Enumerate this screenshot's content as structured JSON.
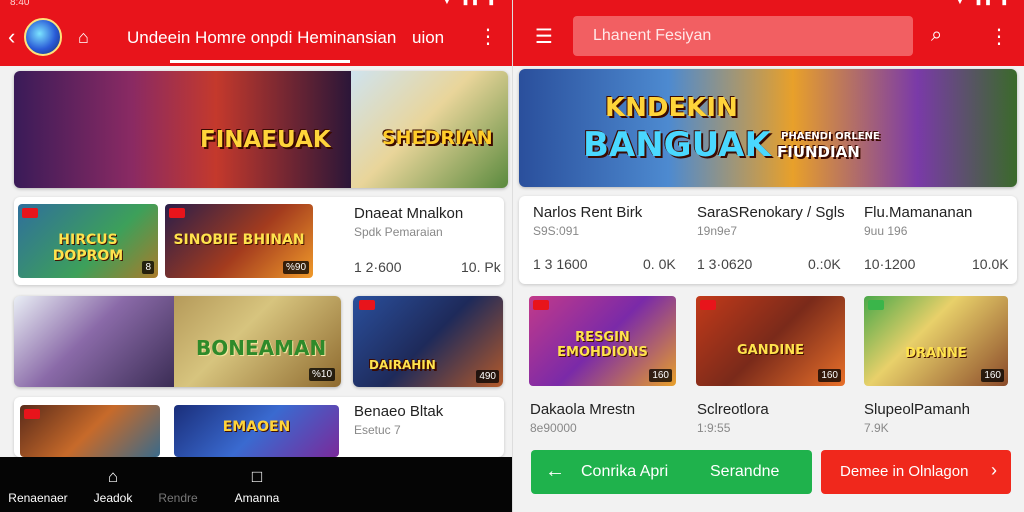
{
  "colors": {
    "primary": "#e8141b",
    "green": "#1fb24c",
    "red_button": "#f0281c",
    "nav_bg": "#050505"
  },
  "left": {
    "status": {
      "time": "8:40"
    },
    "header": {
      "back_icon": "chevron-left-icon",
      "home_icon": "home-icon",
      "title": "Undeein Homre onpdi Heminansian",
      "extra": "uion",
      "menu_icon": "more-vertical-icon"
    },
    "banners": [
      {
        "text": "FINAEUAK"
      },
      {
        "text": "SHEDRIAN"
      }
    ],
    "row1": {
      "thumbs": [
        {
          "title": "HIRCUS DOPROM",
          "badge": "8"
        },
        {
          "title": "SINOBIE BHINAN",
          "badge": "%90"
        }
      ],
      "title": "Dnaeat Mnalkon",
      "subtitle": "Spdk Pemaraian",
      "stat_left": "1 2·600",
      "stat_right": "10. Pk"
    },
    "row2": {
      "thumbs": [
        {
          "title": "",
          "badge": ""
        },
        {
          "title": "BONEAMAN",
          "badge": "%10"
        },
        {
          "title": "DAIRAHIN",
          "badge": "490"
        }
      ]
    },
    "row3": {
      "title": "Benaeo Bltak",
      "subtitle": "Esetuc 7",
      "thumbs": [
        {
          "title": "",
          "badge": ""
        },
        {
          "title": "EMAOEN",
          "badge": ""
        }
      ]
    },
    "bottom_nav": [
      {
        "label": "Renaenaer",
        "icon": ""
      },
      {
        "label": "Jeadok",
        "icon": "home-icon"
      },
      {
        "label": "Rendre",
        "icon": ""
      },
      {
        "label": "Amanna",
        "icon": "square-icon"
      }
    ]
  },
  "right": {
    "header": {
      "menu_icon": "hamburger-icon",
      "search_placeholder": "Lhanent Fesiyan",
      "search_icon": "search-icon",
      "more_icon": "more-vertical-icon"
    },
    "banner": {
      "title_line1": "KNDEKIN",
      "title_line2": "BANGUAK",
      "side_line1": "PHAENDI ORLENE",
      "side_line2": "FIUNDIAN"
    },
    "row1": [
      {
        "title": "Narlos Rent Birk",
        "subtitle": "S9S:091",
        "stat_left": "1 3 1600",
        "stat_right": "0. 0K"
      },
      {
        "title": "SaraSRenokary / Sgls",
        "subtitle": "19n9e7",
        "stat_left": "1 3·0620",
        "stat_right": "0.:0K"
      },
      {
        "title": "Flu.Mamananan",
        "subtitle": "9uu 196",
        "stat_left": "10·1200",
        "stat_right": "10.0K"
      }
    ],
    "row2": [
      {
        "thumb_title": "RESGIN EMOHDIONS",
        "badge": "160",
        "title": "Dakaola Mrestn",
        "subtitle": "8e90000"
      },
      {
        "thumb_title": "GANDINE",
        "badge": "160",
        "title": "Sclreotlora",
        "subtitle": "1:9:55"
      },
      {
        "thumb_title": "DRANNE",
        "badge": "160",
        "title": "SlupeolPamanh",
        "subtitle": "7.9K"
      }
    ],
    "buttons": {
      "green_icon": "arrow-left-icon",
      "green_label_1": "Conrika Apri",
      "green_label_2": "Serandne",
      "red_label": "Demee in Olnlagon",
      "red_icon": "chevron-right-icon"
    }
  }
}
